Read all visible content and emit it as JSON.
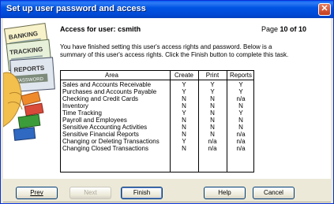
{
  "window": {
    "title": "Set up user password and access",
    "close_glyph": "✕"
  },
  "header": {
    "access_label": "Access for user:",
    "username": "csmith",
    "page_prefix": "Page",
    "page_value": "10 of 10"
  },
  "description": "You have finished setting this user's access rights and password. Below is a summary of this user's access rights.  Click the Finish button to complete this task.",
  "illustration": {
    "signs": [
      "BANKING",
      "TRACKING",
      "REPORTS",
      "PASSWORD"
    ]
  },
  "table": {
    "columns": [
      "Area",
      "Create",
      "Print",
      "Reports"
    ],
    "rows": [
      {
        "area": "Sales and Accounts Receivable",
        "create": "Y",
        "print": "Y",
        "reports": "Y"
      },
      {
        "area": "Purchases and Accounts Payable",
        "create": "Y",
        "print": "Y",
        "reports": "Y"
      },
      {
        "area": "Checking and Credit Cards",
        "create": "N",
        "print": "N",
        "reports": "n/a"
      },
      {
        "area": "Inventory",
        "create": "N",
        "print": "N",
        "reports": "N"
      },
      {
        "area": "Time Tracking",
        "create": "Y",
        "print": "N",
        "reports": "Y"
      },
      {
        "area": "Payroll and Employees",
        "create": "N",
        "print": "N",
        "reports": "N"
      },
      {
        "area": "Sensitive Accounting Activities",
        "create": "N",
        "print": "N",
        "reports": "N"
      },
      {
        "area": "Sensitive Financial Reports",
        "create": "N",
        "print": "N",
        "reports": "n/a"
      },
      {
        "area": "Changing or Deleting Transactions",
        "create": "Y",
        "print": "n/a",
        "reports": "n/a"
      },
      {
        "area": "Changing Closed Transactions",
        "create": "N",
        "print": "n/a",
        "reports": "n/a"
      }
    ]
  },
  "buttons": {
    "prev": "Prev",
    "next": "Next",
    "finish": "Finish",
    "help": "Help",
    "cancel": "Cancel"
  },
  "colors": {
    "titlebar": "#0054e3",
    "dialog_bg": "#ece9d8",
    "disabled_text": "#aca899"
  }
}
